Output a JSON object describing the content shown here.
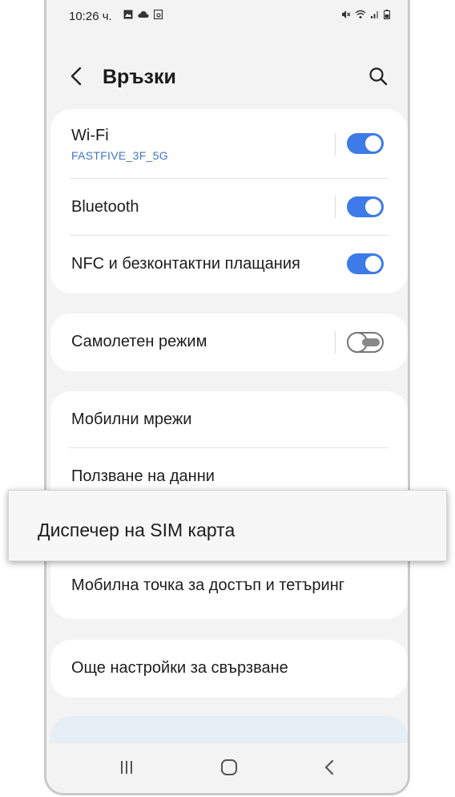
{
  "status_bar": {
    "time": "10:26 ч.",
    "left_icons": [
      "image-icon",
      "cloud-icon",
      "screenshot-icon"
    ],
    "right_icons": [
      "mute-icon",
      "wifi-icon",
      "signal-icon",
      "battery-icon"
    ]
  },
  "header": {
    "title": "Връзки",
    "back_icon": "chevron-left-icon",
    "search_icon": "search-icon"
  },
  "groups": [
    {
      "items": [
        {
          "label": "Wi-Fi",
          "sub": "FASTFIVE_3F_5G",
          "toggle": "on"
        },
        {
          "label": "Bluetooth",
          "toggle": "on"
        },
        {
          "label": "NFC и безконтактни плащания",
          "toggle": "on"
        }
      ]
    },
    {
      "items": [
        {
          "label": "Самолетен режим",
          "toggle": "off"
        }
      ]
    },
    {
      "items": [
        {
          "label": "Мобилни мрежи"
        },
        {
          "label": "Ползване на данни"
        },
        {
          "label": "Мобилна точка за достъп и тетъринг"
        }
      ]
    },
    {
      "items": [
        {
          "label": "Още настройки за свързване"
        }
      ]
    }
  ],
  "highlight": {
    "label": "Диспечер на SIM карта"
  },
  "accent_color": "#3c7be8",
  "link_color": "#3e76c6",
  "navbar": {
    "icons": [
      "recent-apps-icon",
      "home-icon",
      "back-icon"
    ]
  }
}
